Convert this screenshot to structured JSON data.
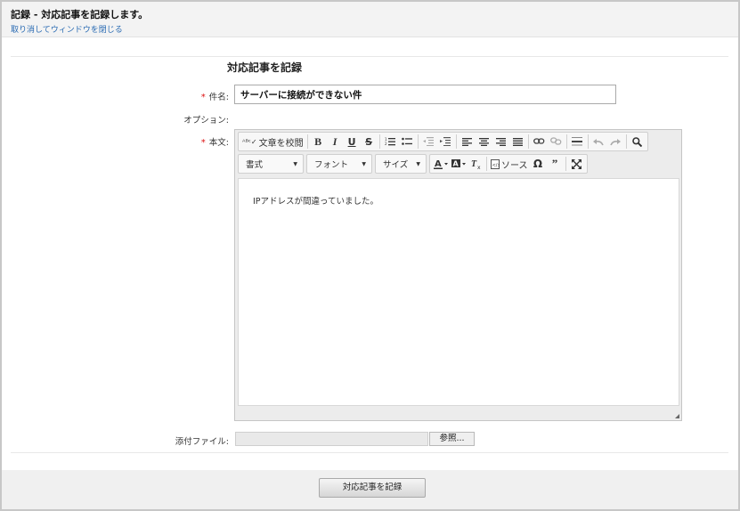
{
  "header": {
    "title": "記録 - 対応記事を記録します。",
    "close_link": "取り消してウィンドウを閉じる"
  },
  "form": {
    "heading": "対応記事を記録",
    "subject_label": "件名:",
    "subject_value": "サーバーに接続ができない件",
    "option_label": "オプション:",
    "body_label": "本文:",
    "required_mark": "*",
    "attachment_label": "添付ファイル:",
    "browse_label": "参照..."
  },
  "editor": {
    "spellcheck_label": "文章を校閲",
    "format_label": "書式",
    "font_label": "フォント",
    "size_label": "サイズ",
    "source_label": "ソース",
    "body_text": "IPアドレスが間違っていました。"
  },
  "footer": {
    "submit_label": "対応記事を記録"
  }
}
